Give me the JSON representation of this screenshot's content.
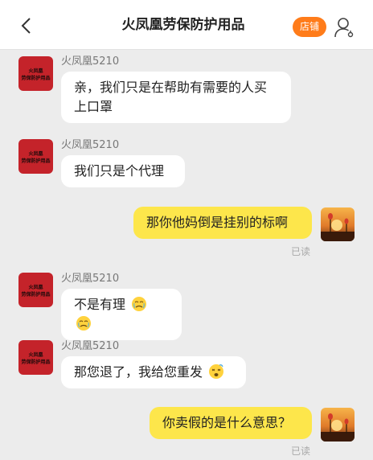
{
  "header": {
    "title": "火凤凰劳保防护用品",
    "shop_label": "店铺"
  },
  "contact": {
    "name": "火凤凰5210",
    "avatar_text_line1": "火凤凰",
    "avatar_text_line2": "劳保防护用品"
  },
  "messages": [
    {
      "sender": "火凤凰5210",
      "text": "亲，我们只是在帮助有需要的人买上口罩"
    },
    {
      "sender": "火凤凰5210",
      "text": "我们只是个代理"
    },
    {
      "sender": "me",
      "text": "那你他妈倒是挂别的标啊",
      "status": "已读"
    },
    {
      "sender": "火凤凰5210",
      "text": "不是有理",
      "emojis": [
        "crying-face",
        "crying-face"
      ]
    },
    {
      "sender": "火凤凰5210",
      "text": "那您退了，我给您重发",
      "emojis": [
        "dizzy-face"
      ]
    },
    {
      "sender": "me",
      "text": "你卖假的是什么意思？",
      "status": "已读"
    }
  ],
  "colors": {
    "accent": "#ff7c1a",
    "outgoing_bubble": "#fde64b",
    "incoming_bubble": "#ffffff",
    "background": "#ececec",
    "avatar_red": "#c4232a"
  }
}
